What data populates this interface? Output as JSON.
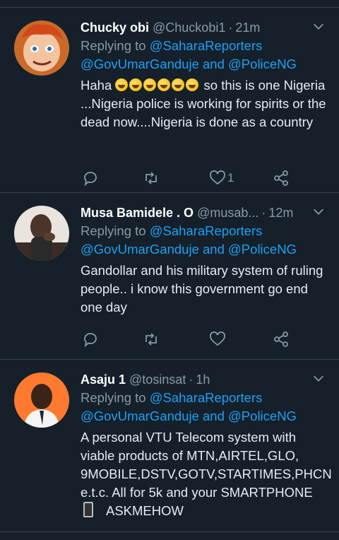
{
  "tweets": [
    {
      "name": "Chucky obi",
      "handle": "@Chuckobi1",
      "dot": "·",
      "time": "21m",
      "replying_prefix": "Replying to ",
      "replying_to_1": "@SaharaReporters",
      "replying_to_2": "@GovUmarGanduje",
      "replying_and": " and ",
      "replying_to_3": "@PoliceNG",
      "text_lead": "Haha",
      "text_after_emoji": " so this is one Nigeria ...Nigeria police is working for spirits or the dead now....Nigeria is done as a country",
      "emoji_count": 6,
      "like_count": "1",
      "avatar_colors": [
        "#ffdbb0",
        "#c2410c"
      ]
    },
    {
      "name": "Musa Bamidele . O",
      "handle": "@musab...",
      "dot": "·",
      "time": "12m",
      "replying_prefix": "Replying to ",
      "replying_to_1": "@SaharaReporters",
      "replying_to_2": "@GovUmarGanduje",
      "replying_and": " and ",
      "replying_to_3": "@PoliceNG",
      "text": "Gandollar and his military system of ruling people.. i know this government go end one day",
      "like_count": "",
      "avatar_colors": [
        "#e9e4dd",
        "#4b3529"
      ]
    },
    {
      "name": "Asaju 1",
      "handle": "@tosinsat",
      "dot": "·",
      "time": "1h",
      "replying_prefix": "Replying to ",
      "replying_to_1": "@SaharaReporters",
      "replying_to_2": "@GovUmarGanduje",
      "replying_and": " and ",
      "replying_to_3": "@PoliceNG",
      "text_main": "A personal VTU Telecom system with viable products of MTN,AIRTEL,GLO, 9MOBILE,DSTV,GOTV,STARTIMES,PHCN e.t.c. All for 5k  and your SMARTPHONE",
      "text_tail": "ASKMEHOW",
      "like_count": "",
      "avatar_colors": [
        "#ff7a2f",
        "#3a2418"
      ]
    }
  ],
  "icons": [
    "reply-icon",
    "retweet-icon",
    "like-icon",
    "share-icon",
    "chevron-down-icon",
    "rofl-emoji",
    "mobile-phone-emoji"
  ],
  "colors": {
    "background": "#15202b",
    "link": "#1da1f2",
    "muted": "#8899a6",
    "divider": "#38444d"
  }
}
